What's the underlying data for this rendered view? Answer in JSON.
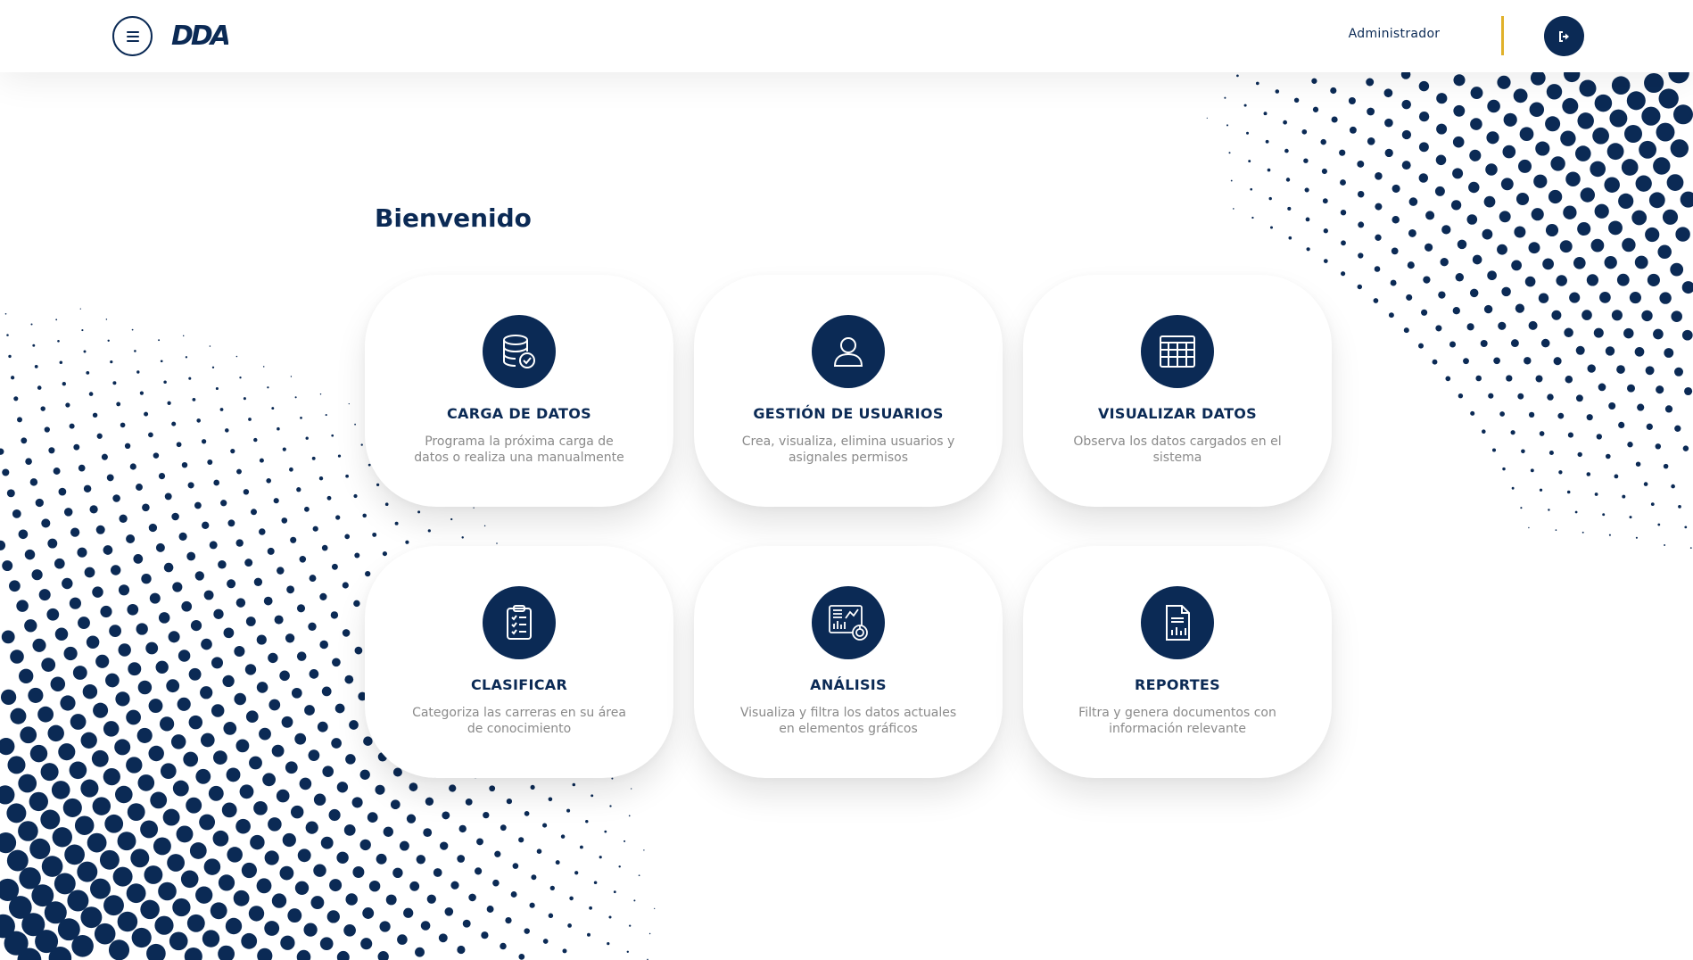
{
  "header": {
    "logo_text": "DDA",
    "user_label": "Administrador",
    "menu_icon": "hamburger-icon",
    "logout_icon": "logout-icon"
  },
  "main": {
    "title": "Bienvenido",
    "cards": [
      {
        "title": "CARGA DE DATOS",
        "description": "Programa la próxima carga de datos o realiza una manualmente",
        "icon": "database-check-icon"
      },
      {
        "title": "GESTIÓN DE USUARIOS",
        "description": "Crea, visualiza, elimina usuarios y asignales permisos",
        "icon": "user-icon"
      },
      {
        "title": "VISUALIZAR DATOS",
        "description": "Observa los datos cargados en el sistema",
        "icon": "table-grid-icon"
      },
      {
        "title": "CLASIFICAR",
        "description": "Categoriza las carreras en su área de conocimiento",
        "icon": "clipboard-checklist-icon"
      },
      {
        "title": "ANÁLISIS",
        "description": "Visualiza y filtra los datos actuales en elementos gráficos",
        "icon": "analytics-chart-icon"
      },
      {
        "title": "REPORTES",
        "description": "Filtra y genera documentos con información relevante",
        "icon": "report-document-icon"
      }
    ]
  },
  "colors": {
    "primary": "#0b2a55",
    "accent": "#e0b12a",
    "muted_text": "#8a8a8a",
    "background": "#ffffff"
  }
}
